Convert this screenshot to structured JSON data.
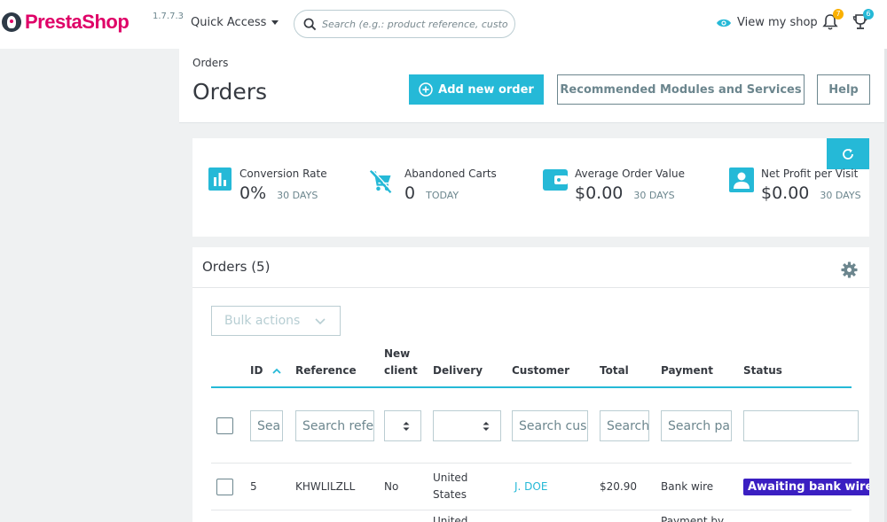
{
  "header": {
    "brand": "PrestaShop",
    "version": "1.7.7.3",
    "quick_access": "Quick Access",
    "search_placeholder": "Search (e.g.: product reference, customer name…)",
    "view_shop": "View my shop",
    "notif_orders_count": "7",
    "notif_customers_count": "6"
  },
  "toolbar": {
    "breadcrumb": "Orders",
    "title": "Orders",
    "add_order": "Add new order",
    "modules": "Recommended Modules and Services",
    "help": "Help"
  },
  "kpis": [
    {
      "label": "Conversion Rate",
      "value": "0%",
      "period": "30 DAYS",
      "icon": "bar-chart-icon"
    },
    {
      "label": "Abandoned Carts",
      "value": "0",
      "period": "TODAY",
      "icon": "cart-off-icon"
    },
    {
      "label": "Average Order Value",
      "value": "$0.00",
      "period": "30 DAYS",
      "icon": "wallet-icon"
    },
    {
      "label": "Net Profit per Visit",
      "value": "$0.00",
      "period": "30 DAYS",
      "icon": "account-box-icon"
    }
  ],
  "orders": {
    "title": "Orders (5)",
    "bulk_actions": "Bulk actions",
    "columns": [
      "ID",
      "Reference",
      "New client",
      "Delivery",
      "Customer",
      "Total",
      "Payment",
      "Status"
    ],
    "column_new_1": "New",
    "column_new_2": "client",
    "filters": {
      "id": "Sea",
      "reference": "Search refe",
      "customer": "Search cus",
      "total": "Search",
      "payment": "Search pa"
    },
    "rows": [
      {
        "id": "5",
        "reference": "KHWLILZLL",
        "new_client": "No",
        "delivery_1": "United",
        "delivery_2": "States",
        "customer": "J. DOE",
        "total": "$20.90",
        "payment": "Bank wire",
        "status": "Awaiting bank wire payment"
      }
    ],
    "next_row_partial": {
      "delivery": "United",
      "payment": "Payment by"
    }
  },
  "colors": {
    "brand": "#df0067",
    "accent": "#25b9d7",
    "status": "#3b1fc2"
  }
}
